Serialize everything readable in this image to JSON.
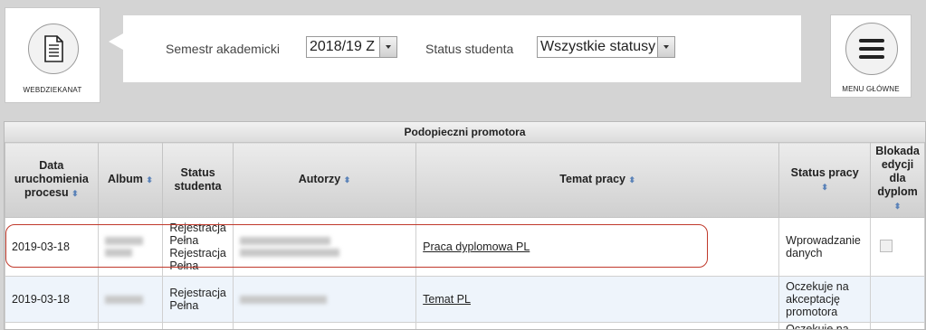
{
  "logo": {
    "label": "WEBDZIEKANAT",
    "icon": "document-icon"
  },
  "menu": {
    "label": "MENU GŁÓWNE",
    "icon": "hamburger-icon"
  },
  "filters": {
    "semester": {
      "label": "Semestr akademicki",
      "value": "2018/19 Z"
    },
    "status": {
      "label": "Status studenta",
      "value": "Wszystkie statusy"
    }
  },
  "table": {
    "caption": "Podopieczni promotora",
    "headers": {
      "date": "Data uruchomienia procesu",
      "album": "Album",
      "student_status": "Status studenta",
      "authors": "Autorzy",
      "topic": "Temat pracy",
      "work_status": "Status pracy",
      "block": "Blokada edycji dla dyplom"
    },
    "rows": [
      {
        "date": "2019-03-18",
        "student_status": "Rejestracja Pełna Rejestracja Pełna",
        "topic": "Praca dyplomowa PL",
        "work_status": "Wprowadzanie danych"
      },
      {
        "date": "2019-03-18",
        "student_status": "Rejestracja Pełna",
        "topic": "Temat PL",
        "work_status": "Oczekuje na akceptację promotora"
      },
      {
        "work_status": "Oczekuje na"
      }
    ]
  }
}
